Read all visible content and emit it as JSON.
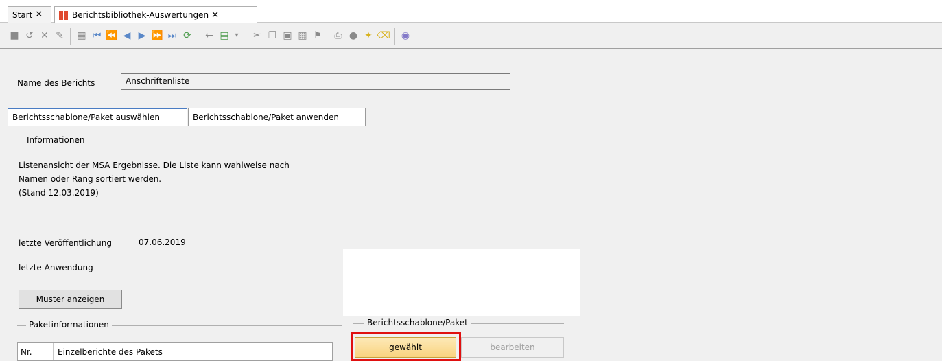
{
  "tabs": [
    {
      "label": "Start",
      "active": false
    },
    {
      "label": "Berichtsbibliothek-Auswertungen",
      "active": true
    }
  ],
  "tab_close_glyph": "✕",
  "toolbar": {
    "icons": [
      "save-icon",
      "undo-icon",
      "delete-icon",
      "edit-icon",
      "new-record-icon",
      "first-icon",
      "fast-back-icon",
      "prev-icon",
      "next-icon",
      "fast-forward-icon",
      "last-icon",
      "refresh-icon",
      "back-arrow-icon",
      "export-icon",
      "dropdown-arrow-icon",
      "cut-icon",
      "copy-icon",
      "paste-icon",
      "document-icon",
      "flag-icon",
      "print-icon",
      "disk-icon",
      "lightbulb-icon",
      "broom-icon",
      "help-icon"
    ]
  },
  "report": {
    "name_label": "Name des Berichts",
    "name_value": "Anschriftenliste"
  },
  "panel_tabs": [
    {
      "label": "Berichtsschablone/Paket auswählen",
      "active": true
    },
    {
      "label": "Berichtsschablone/Paket anwenden",
      "active": false
    }
  ],
  "info": {
    "group_title": "Informationen",
    "lines": [
      "Listenansicht der MSA Ergebnisse. Die Liste kann wahlweise nach",
      "Namen oder Rang sortiert werden.",
      "(Stand 12.03.2019)"
    ]
  },
  "publish": {
    "last_publish_label": "letzte Veröffentlichung",
    "last_publish_value": "07.06.2019",
    "last_use_label": "letzte Anwendung",
    "last_use_value": ""
  },
  "buttons": {
    "show_sample": "Muster anzeigen",
    "selected": "gewählt",
    "edit": "bearbeiten"
  },
  "package": {
    "group_title": "Paketinformationen",
    "columns": [
      "Nr.",
      "Einzelberichte des Pakets"
    ]
  },
  "template_group": {
    "title": "Berichtsschablone/Paket"
  },
  "colors": {
    "accent_tab": "#4a7cc3",
    "highlight": "#e01010",
    "selected_button": "#f9d480"
  }
}
